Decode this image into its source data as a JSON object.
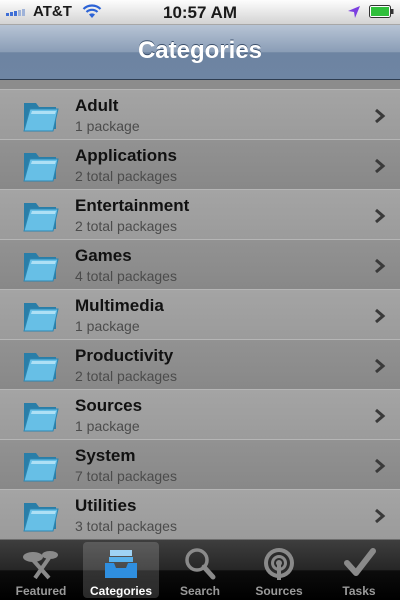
{
  "status_bar": {
    "carrier": "AT&T",
    "time": "10:57 AM"
  },
  "nav": {
    "title": "Categories"
  },
  "categories": [
    {
      "name": "Adult",
      "count": "1 package"
    },
    {
      "name": "Applications",
      "count": "2 total packages"
    },
    {
      "name": "Entertainment",
      "count": "2 total packages"
    },
    {
      "name": "Games",
      "count": "4 total packages"
    },
    {
      "name": "Multimedia",
      "count": "1 package"
    },
    {
      "name": "Productivity",
      "count": "2 total packages"
    },
    {
      "name": "Sources",
      "count": "1 package"
    },
    {
      "name": "System",
      "count": "7 total packages"
    },
    {
      "name": "Utilities",
      "count": "3 total packages"
    }
  ],
  "tabs": [
    {
      "label": "Featured",
      "icon": "featured-icon"
    },
    {
      "label": "Categories",
      "icon": "categories-tray-icon",
      "active": true
    },
    {
      "label": "Search",
      "icon": "search-icon"
    },
    {
      "label": "Sources",
      "icon": "sources-broadcast-icon"
    },
    {
      "label": "Tasks",
      "icon": "checkmark-icon"
    }
  ],
  "colors": {
    "nav_bar": "#7a8fab",
    "list_row_light": "#a0a0a0",
    "list_row_dark": "#8d8d8d",
    "folder_blue": "#5fb8e0",
    "tab_bar": "#1a1a1a"
  }
}
